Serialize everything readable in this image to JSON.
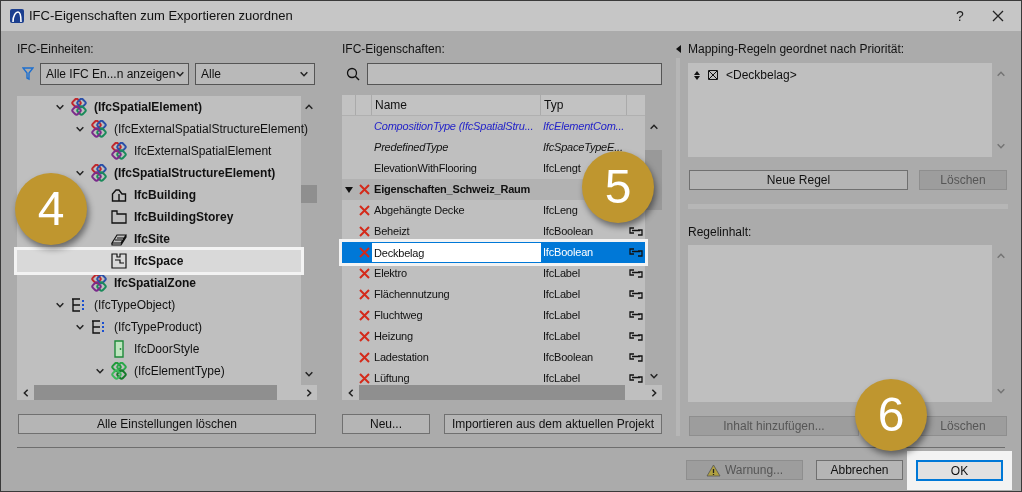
{
  "window": {
    "title": "IFC-Eigenschaften zum Exportieren zuordnen",
    "help": "?"
  },
  "units_panel": {
    "label": "IFC-Einheiten:",
    "filter_value": "Alle IFC En...n anzeigen",
    "type_value": "Alle",
    "tree": [
      {
        "label": "(IfcSpatialElement)",
        "kind": "rings",
        "bold": true,
        "expanded": true,
        "selected": false,
        "children": [
          {
            "label": "(IfcExternalSpatialStructureElement)",
            "kind": "rings",
            "bold": false,
            "expanded": true,
            "selected": false,
            "children": [
              {
                "label": "IfcExternalSpatialElement",
                "kind": "rings",
                "bold": false,
                "selected": false
              }
            ]
          },
          {
            "label": "(IfcSpatialStructureElement)",
            "kind": "rings",
            "bold": true,
            "expanded": true,
            "selected": false,
            "children": [
              {
                "label": "IfcBuilding",
                "kind": "building",
                "bold": true,
                "selected": false
              },
              {
                "label": "IfcBuildingStorey",
                "kind": "storey",
                "bold": true,
                "selected": false
              },
              {
                "label": "IfcSite",
                "kind": "site",
                "bold": true,
                "selected": false
              },
              {
                "label": "IfcSpace",
                "kind": "space",
                "bold": true,
                "selected": true
              }
            ]
          },
          {
            "label": "IfcSpatialZone",
            "kind": "rings",
            "bold": true,
            "selected": false
          }
        ]
      },
      {
        "label": "(IfcTypeObject)",
        "kind": "type",
        "bold": false,
        "expanded": true,
        "selected": false,
        "children": [
          {
            "label": "(IfcTypeProduct)",
            "kind": "type",
            "bold": false,
            "expanded": true,
            "selected": false,
            "children": [
              {
                "label": "IfcDoorStyle",
                "kind": "door",
                "bold": false,
                "selected": false
              },
              {
                "label": "(IfcElementType)",
                "kind": "green-rings",
                "bold": false,
                "expanded": true,
                "selected": false
              }
            ]
          }
        ]
      }
    ],
    "clear_button": "Alle Einstellungen löschen"
  },
  "properties_panel": {
    "label": "IFC-Eigenschaften:",
    "columns": [
      "Name",
      "Typ"
    ],
    "rows": [
      {
        "kind": "inherited",
        "name": "CompositionType (IfcSpatialStru...",
        "type": "IfcElementCom...",
        "linked": false,
        "selected": false
      },
      {
        "kind": "predefined",
        "name": "PredefinedType",
        "type": "IfcSpaceTypeE...",
        "linked": false,
        "selected": false
      },
      {
        "kind": "standard",
        "name": "ElevationWithFlooring",
        "type": "IfcLengt",
        "linked": false,
        "selected": false
      },
      {
        "kind": "group",
        "name": "Eigenschaften_Schweiz_Raum",
        "expanded": true,
        "linked": false,
        "selected": false
      },
      {
        "kind": "custom",
        "name": "Abgehängte Decke",
        "type": "IfcLeng",
        "linked": false,
        "selected": false
      },
      {
        "kind": "custom",
        "name": "Beheizt",
        "type": "IfcBoolean",
        "linked": true,
        "selected": false
      },
      {
        "kind": "custom",
        "name": "Deckbelag",
        "type": "IfcBoolean",
        "linked": true,
        "selected": true
      },
      {
        "kind": "custom",
        "name": "Elektro",
        "type": "IfcLabel",
        "linked": true,
        "selected": false
      },
      {
        "kind": "custom",
        "name": "Flächennutzung",
        "type": "IfcLabel",
        "linked": true,
        "selected": false
      },
      {
        "kind": "custom",
        "name": "Fluchtweg",
        "type": "IfcLabel",
        "linked": true,
        "selected": false
      },
      {
        "kind": "custom",
        "name": "Heizung",
        "type": "IfcLabel",
        "linked": true,
        "selected": false
      },
      {
        "kind": "custom",
        "name": "Ladestation",
        "type": "IfcBoolean",
        "linked": true,
        "selected": false
      },
      {
        "kind": "custom",
        "name": "Lüftung",
        "type": "IfcLabel",
        "linked": true,
        "selected": false
      }
    ],
    "new_button": "Neu...",
    "import_button": "Importieren aus dem aktuellen Projekt"
  },
  "rules_panel": {
    "label": "Mapping-Regeln geordnet nach Priorität:",
    "rules": [
      "<Deckbelag>"
    ],
    "new_rule_button": "Neue Regel",
    "delete_button": {
      "label": "Löschen",
      "disabled": true
    },
    "content_label": "Regelinhalt:",
    "add_content_button": {
      "label": "Inhalt hinzufügen...",
      "disabled": true
    },
    "delete_content_button": {
      "label": "Löschen",
      "disabled": true
    }
  },
  "footer": {
    "warning_button": {
      "label": "Warnung...",
      "disabled": true
    },
    "cancel_button": "Abbrechen",
    "ok_button": {
      "label": "OK",
      "focused": true
    }
  },
  "callouts": [
    {
      "number": "4"
    },
    {
      "number": "5"
    },
    {
      "number": "6"
    }
  ]
}
